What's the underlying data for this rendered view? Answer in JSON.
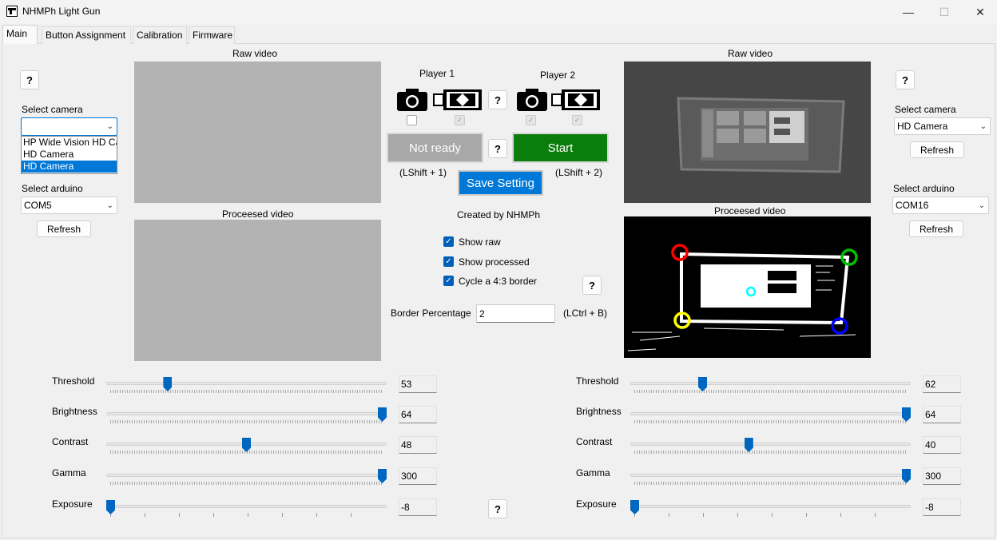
{
  "window": {
    "title": "NHMPh Light Gun",
    "minimize": "—",
    "maximize": "☐",
    "close": "✕"
  },
  "tabs": [
    "Main",
    "Button Assignment",
    "Calibration",
    "Firmware"
  ],
  "help": "?",
  "left": {
    "select_camera_label": "Select camera",
    "camera_value": "",
    "camera_options": [
      "HP Wide Vision HD Camera",
      "HD Camera",
      "HD Camera"
    ],
    "camera_selected_index": 2,
    "select_arduino_label": "Select arduino",
    "arduino_value": "COM5",
    "refresh_label": "Refresh",
    "raw_video_label": "Raw video",
    "processed_video_label": "Proceesed video"
  },
  "right": {
    "select_camera_label": "Select camera",
    "camera_value": "HD Camera",
    "refresh_label": "Refresh",
    "select_arduino_label": "Select arduino",
    "arduino_value": "COM16",
    "refresh2_label": "Refresh",
    "raw_video_label": "Raw video",
    "processed_video_label": "Proceesed video"
  },
  "center": {
    "player1_label": "Player 1",
    "player2_label": "Player 2",
    "player1_status": "Not ready",
    "player2_button": "Start",
    "player1_hotkey": "(LShift + 1)",
    "player2_hotkey": "(LShift + 2)",
    "save_setting": "Save Setting",
    "created_by": "Created by NHMPh",
    "show_raw": "Show raw",
    "show_processed": "Show processed",
    "cycle_border": "Cycle a 4:3 border",
    "show_raw_checked": true,
    "show_processed_checked": true,
    "cycle_border_checked": true,
    "border_percentage_label": "Border Percentage",
    "border_percentage_value": "2",
    "border_hotkey": "(LCtrl + B)",
    "p1_camera_checked": false,
    "p1_mode_checked": true,
    "p2_camera_checked": true,
    "p2_mode_checked": true
  },
  "sliders_left": [
    {
      "label": "Threshold",
      "value": "53",
      "level": 0.21
    },
    {
      "label": "Brightness",
      "value": "64",
      "level": 1.0
    },
    {
      "label": "Contrast",
      "value": "48",
      "level": 0.5
    },
    {
      "label": "Gamma",
      "value": "300",
      "level": 1.0
    },
    {
      "label": "Exposure",
      "value": "-8",
      "level": 0.0
    }
  ],
  "sliders_right": [
    {
      "label": "Threshold",
      "value": "62",
      "level": 0.25
    },
    {
      "label": "Brightness",
      "value": "64",
      "level": 1.0
    },
    {
      "label": "Contrast",
      "value": "40",
      "level": 0.42
    },
    {
      "label": "Gamma",
      "value": "300",
      "level": 1.0
    },
    {
      "label": "Exposure",
      "value": "-8",
      "level": 0.0
    }
  ],
  "colors": {
    "accent": "#0078d7",
    "start_green": "#0a7d0a",
    "not_ready_gray": "#a8a8a8",
    "marker_red": "#ff0000",
    "marker_green": "#00c000",
    "marker_yellow": "#ffff00",
    "marker_blue": "#0000ff",
    "marker_cyan": "#00ffff"
  }
}
